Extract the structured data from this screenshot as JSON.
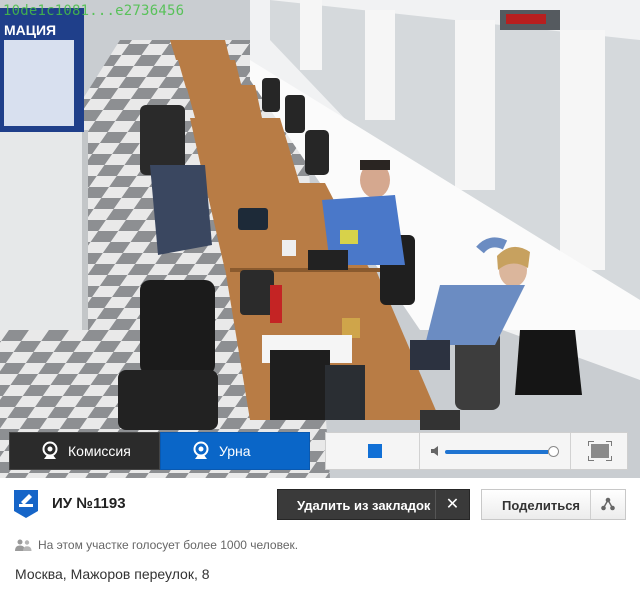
{
  "video": {
    "watermark": "10de1c1081...e2736456",
    "sign_text": "МАЦИЯ"
  },
  "controls": {
    "camera_komissiya": "Комиссия",
    "camera_urna": "Урна",
    "volume_level": 0.92
  },
  "station": {
    "title": "ИУ №1193",
    "voters_note": "На этом участке голосует более 1000 человек.",
    "address": "Москва, Мажоров переулок, 8"
  },
  "actions": {
    "remove_bookmark_label": "Удалить из закладок",
    "share_label": "Поделиться"
  },
  "colors": {
    "accent_blue": "#0a66c8",
    "dark_button": "#3a3a3a"
  }
}
